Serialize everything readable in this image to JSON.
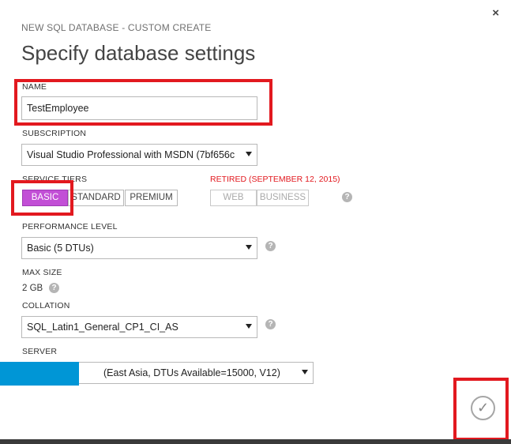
{
  "dialog": {
    "subtitle": "NEW SQL DATABASE - CUSTOM CREATE",
    "title": "Specify database settings",
    "close_icon": "×"
  },
  "name": {
    "label": "NAME",
    "value": "TestEmployee"
  },
  "subscription": {
    "label": "SUBSCRIPTION",
    "value": "Visual Studio Professional with MSDN (7bf656c"
  },
  "service_tiers": {
    "label": "SERVICE TIERS",
    "tiers": [
      "BASIC",
      "STANDARD",
      "PREMIUM"
    ],
    "selected": "BASIC",
    "retired_label": "RETIRED (SEPTEMBER 12, 2015)",
    "retired_tiers": [
      "WEB",
      "BUSINESS"
    ]
  },
  "performance": {
    "label": "PERFORMANCE LEVEL",
    "value": "Basic (5 DTUs)"
  },
  "max_size": {
    "label": "MAX SIZE",
    "value": "2 GB"
  },
  "collation": {
    "label": "COLLATION",
    "value": "SQL_Latin1_General_CP1_CI_AS"
  },
  "server": {
    "label": "SERVER",
    "value": "(East Asia, DTUs Available=15000, V12)"
  },
  "help_icon": "?",
  "confirm_icon": "✓",
  "colors": {
    "accent": "#c24fd6",
    "highlight": "#e2191f",
    "redacted": "#0096d6"
  }
}
